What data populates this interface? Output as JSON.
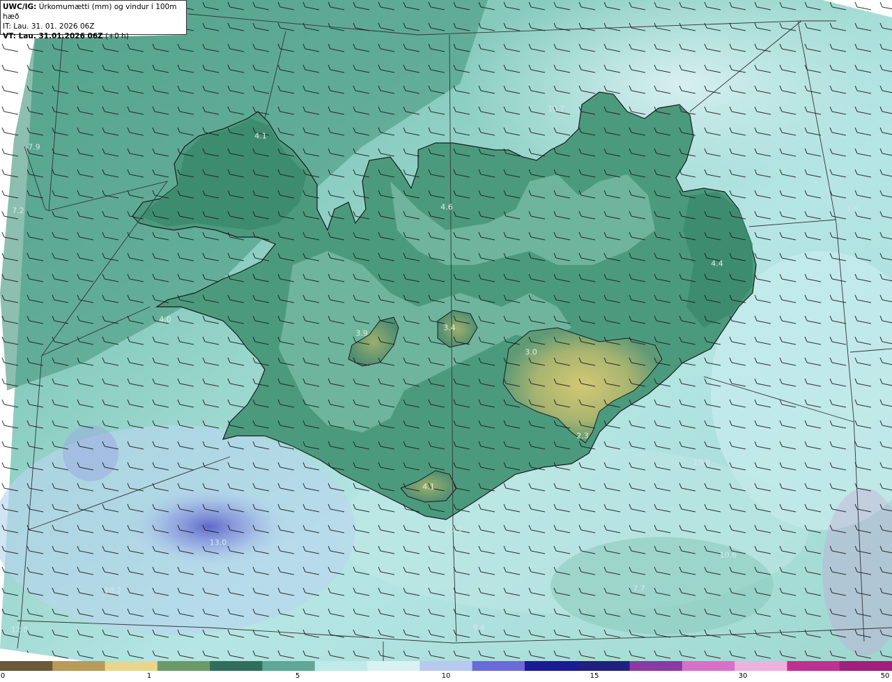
{
  "header": {
    "product": "UWC/IG:",
    "title": "Úrkomumætti (mm) og vindur í 100m hæð",
    "issue_time": "IT: Lau. 31. 01. 2026 06Z",
    "valid_prefix": "VT: Lau. 31.01.2026 06Z",
    "valid_suffix": " (+0 h)"
  },
  "map_values": [
    {
      "text": "4.1"
    },
    {
      "text": "7.9"
    },
    {
      "text": "7.2"
    },
    {
      "text": "4.0"
    },
    {
      "text": "3.9"
    },
    {
      "text": "3.4"
    },
    {
      "text": "4.6"
    },
    {
      "text": "10.7"
    },
    {
      "text": "7.5"
    },
    {
      "text": "4.4"
    },
    {
      "text": "3.0"
    },
    {
      "text": "2.3"
    },
    {
      "text": "10.0"
    },
    {
      "text": "4.1"
    },
    {
      "text": "10.1"
    },
    {
      "text": "13.0"
    },
    {
      "text": "10.6"
    },
    {
      "text": "7.7"
    },
    {
      "text": "10.2"
    },
    {
      "text": "12.0"
    },
    {
      "text": "9.4"
    }
  ],
  "colorbar": {
    "ticks": [
      {
        "label": "0",
        "value": 0
      },
      {
        "label": "1",
        "value": 1
      },
      {
        "label": "5",
        "value": 5
      },
      {
        "label": "10",
        "value": 10
      },
      {
        "label": "15",
        "value": 15
      },
      {
        "label": "30",
        "value": 30
      },
      {
        "label": "50",
        "value": 50
      }
    ],
    "colors": [
      "#6b5a3a",
      "#b89a5a",
      "#e8d68c",
      "#6b9a6a",
      "#2f6e5a",
      "#5fa896",
      "#bfeaea",
      "#d8f2f4",
      "#b8c8f0",
      "#6a6ad8",
      "#1a1a9a",
      "#202080",
      "#8a3aa0",
      "#d870c8",
      "#f0b0e0",
      "#c03090",
      "#a0207a"
    ]
  },
  "colors": {
    "sea_light": "#bfe8e6",
    "sea_mid": "#8fcfc4",
    "land_dark": "#2f7a5e",
    "land_mid": "#4f9a80",
    "highland": "#c8c070",
    "blue_rain": "#6f7fd6"
  }
}
